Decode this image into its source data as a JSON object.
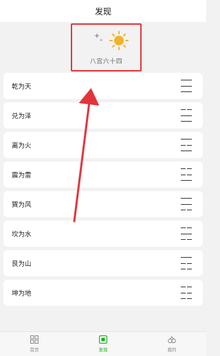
{
  "header": {
    "title": "发现"
  },
  "hero": {
    "caption": "八宫六十四"
  },
  "trigrams": [
    {
      "label": "乾为天",
      "lines": [
        "yang",
        "yang",
        "yang"
      ]
    },
    {
      "label": "兑为泽",
      "lines": [
        "yin",
        "yang",
        "yang"
      ]
    },
    {
      "label": "离为火",
      "lines": [
        "yang",
        "yin",
        "yang"
      ]
    },
    {
      "label": "震为雷",
      "lines": [
        "yin",
        "yin",
        "yang"
      ]
    },
    {
      "label": "巽为风",
      "lines": [
        "yang",
        "yang",
        "yin"
      ]
    },
    {
      "label": "坎为水",
      "lines": [
        "yin",
        "yang",
        "yin"
      ]
    },
    {
      "label": "艮为山",
      "lines": [
        "yang",
        "yin",
        "yin"
      ]
    },
    {
      "label": "坤为地",
      "lines": [
        "yin",
        "yin",
        "yin"
      ]
    }
  ],
  "tabs": [
    {
      "label": "首页",
      "icon": "grid-icon",
      "active": false
    },
    {
      "label": "发现",
      "icon": "discover-icon",
      "active": true
    },
    {
      "label": "我的",
      "icon": "profile-icon",
      "active": false
    }
  ],
  "colors": {
    "highlight": "#e3343c",
    "active_tab": "#1aad19",
    "sun": "#f0b429",
    "moon": "#9a9a9a"
  }
}
